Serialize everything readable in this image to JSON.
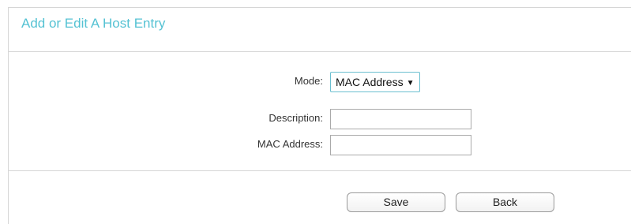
{
  "form": {
    "title": "Add or Edit A Host Entry",
    "mode_label": "Mode:",
    "mode_value": "MAC Address",
    "mode_caret": "▼",
    "description_label": "Description:",
    "description_value": "",
    "mac_label": "MAC Address:",
    "mac_value": ""
  },
  "buttons": {
    "save": "Save",
    "back": "Back"
  },
  "colors": {
    "title": "#55c2d3",
    "select_border": "#6bbfd0",
    "divider": "#d6d6d6"
  }
}
